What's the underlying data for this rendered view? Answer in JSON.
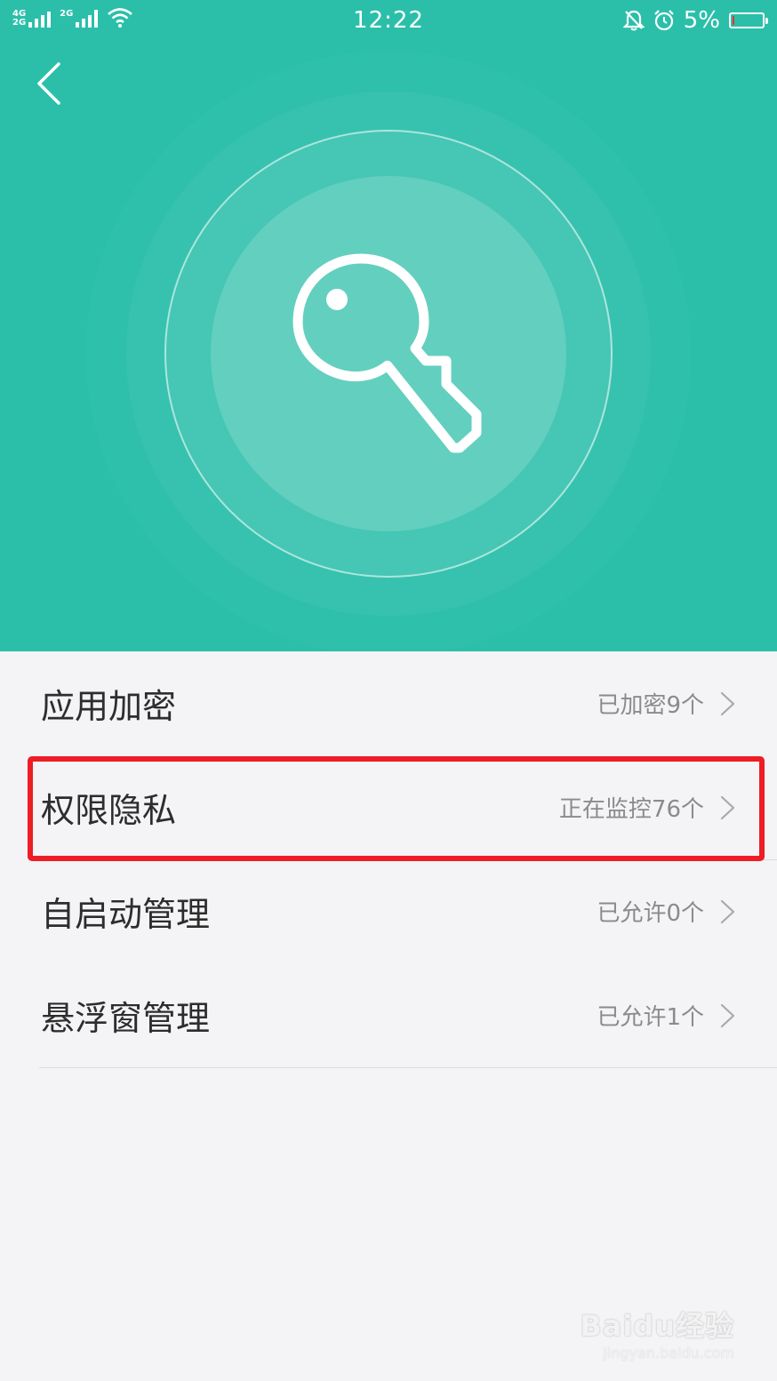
{
  "status_bar": {
    "network_1": "4G",
    "network_1b": "2G",
    "network_2": "2G",
    "time": "12:22",
    "battery_percent": "5%",
    "battery_level": 0.05,
    "icons": [
      "signal-icon",
      "wifi-icon",
      "bell-muted-icon",
      "alarm-icon",
      "battery-icon"
    ]
  },
  "header": {
    "back_icon": "chevron-left-icon",
    "hero_icon": "key-icon",
    "accent_color": "#2bbfaa"
  },
  "list": {
    "items": [
      {
        "label": "应用加密",
        "value": "已加密9个"
      },
      {
        "label": "权限隐私",
        "value": "正在监控76个"
      },
      {
        "label": "自启动管理",
        "value": "已允许0个"
      },
      {
        "label": "悬浮窗管理",
        "value": "已允许1个"
      }
    ]
  },
  "annotation": {
    "highlight_color": "#ee1c25",
    "highlighted_item": "权限隐私"
  },
  "watermark": {
    "main": "Baidu经验",
    "sub": "jingyan.baidu.com"
  }
}
